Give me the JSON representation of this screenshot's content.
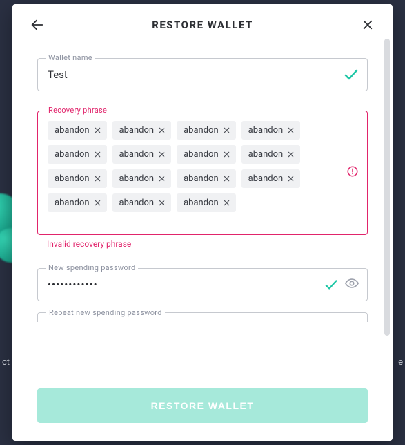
{
  "header": {
    "title": "RESTORE WALLET"
  },
  "wallet_name": {
    "label": "Wallet name",
    "value": "Test"
  },
  "recovery": {
    "label": "Recovery phrase",
    "words": [
      "abandon",
      "abandon",
      "abandon",
      "abandon",
      "abandon",
      "abandon",
      "abandon",
      "abandon",
      "abandon",
      "abandon",
      "abandon",
      "abandon",
      "abandon",
      "abandon",
      "abandon"
    ],
    "error": "Invalid recovery phrase"
  },
  "password": {
    "label": "New spending password",
    "value": "••••••••••••"
  },
  "repeat_password": {
    "label": "Repeat new spending password"
  },
  "actions": {
    "submit": "RESTORE WALLET"
  },
  "bg": {
    "left": "ct",
    "right": "e"
  }
}
